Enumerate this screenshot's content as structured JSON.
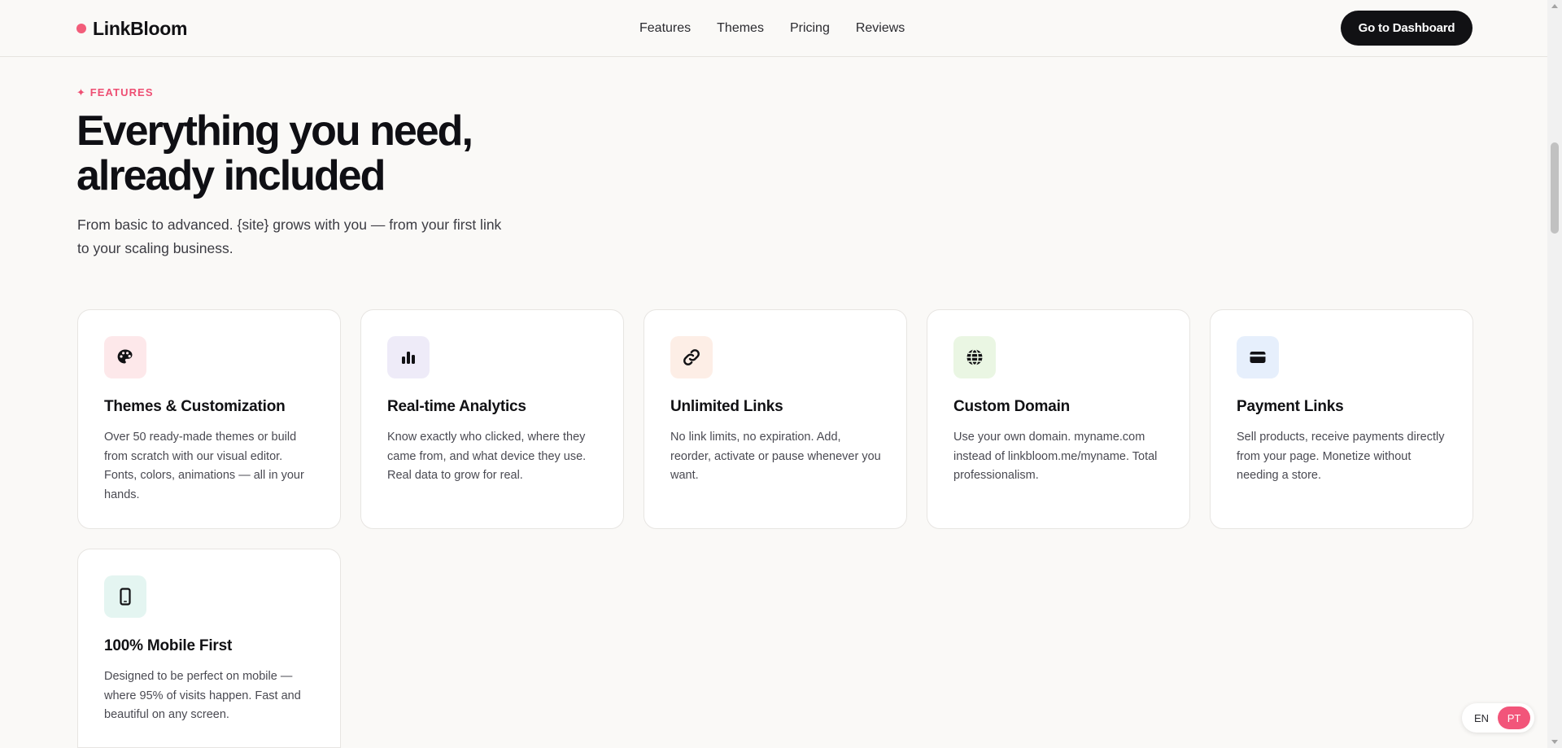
{
  "header": {
    "logo_text": "LinkBloom",
    "nav": [
      {
        "label": "Features"
      },
      {
        "label": "Themes"
      },
      {
        "label": "Pricing"
      },
      {
        "label": "Reviews"
      }
    ],
    "cta_label": "Go to Dashboard"
  },
  "hero": {
    "eyebrow": "✦ FEATURES",
    "title_line1": "Everything you need,",
    "title_line2": "already included",
    "subtitle_line1": "From basic to advanced. {site} grows with you — from your first link",
    "subtitle_line2": "to your scaling business."
  },
  "features": [
    {
      "icon": "palette-icon",
      "icon_bg": "#fde8ea",
      "title": "Themes & Customization",
      "desc": "Over 50 ready-made themes or build from scratch with our visual editor. Fonts, colors, animations — all in your hands."
    },
    {
      "icon": "bar-chart-icon",
      "icon_bg": "#eeebf8",
      "title": "Real-time Analytics",
      "desc": "Know exactly who clicked, where they came from, and what device they use. Real data to grow for real."
    },
    {
      "icon": "link-icon",
      "icon_bg": "#fdeee6",
      "title": "Unlimited Links",
      "desc": "No link limits, no expiration. Add, reorder, activate or pause whenever you want."
    },
    {
      "icon": "globe-icon",
      "icon_bg": "#eaf6e3",
      "title": "Custom Domain",
      "desc": "Use your own domain. myname.com instead of linkbloom.me/myname. Total professionalism."
    },
    {
      "icon": "credit-card-icon",
      "icon_bg": "#e6effc",
      "title": "Payment Links",
      "desc": "Sell products, receive payments directly from your page. Monetize without needing a store."
    },
    {
      "icon": "smartphone-icon",
      "icon_bg": "#e4f5f1",
      "title": "100% Mobile First",
      "desc": "Designed to be perfect on mobile — where 95% of visits happen. Fast and beautiful on any screen."
    }
  ],
  "language": {
    "options": [
      "EN",
      "PT"
    ],
    "selected": "PT"
  },
  "colors": {
    "accent": "#f2557a",
    "dark": "#111114",
    "background": "#faf9f7"
  }
}
